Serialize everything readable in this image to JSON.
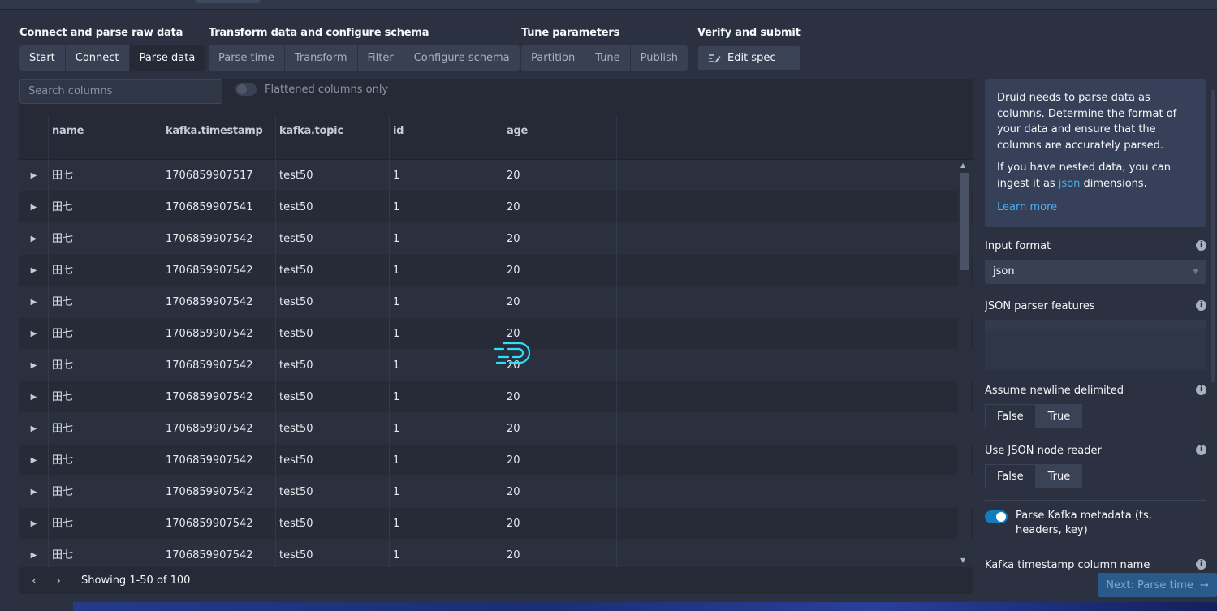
{
  "steps": {
    "group1": {
      "title": "Connect and parse raw data",
      "items": [
        "Start",
        "Connect",
        "Parse data"
      ]
    },
    "group2": {
      "title": "Transform data and configure schema",
      "items": [
        "Parse time",
        "Transform",
        "Filter",
        "Configure schema"
      ]
    },
    "group3": {
      "title": "Tune parameters",
      "items": [
        "Partition",
        "Tune",
        "Publish"
      ]
    },
    "group4": {
      "title": "Verify and submit",
      "edit_spec": "Edit spec"
    }
  },
  "search": {
    "placeholder": "Search columns"
  },
  "flattened_toggle": {
    "label": "Flattened columns only",
    "checked": false
  },
  "table": {
    "columns": [
      "name",
      "kafka.timestamp",
      "kafka.topic",
      "id",
      "age"
    ],
    "rows": [
      [
        "田七",
        "1706859907517",
        "test50",
        "1",
        "20"
      ],
      [
        "田七",
        "1706859907541",
        "test50",
        "1",
        "20"
      ],
      [
        "田七",
        "1706859907542",
        "test50",
        "1",
        "20"
      ],
      [
        "田七",
        "1706859907542",
        "test50",
        "1",
        "20"
      ],
      [
        "田七",
        "1706859907542",
        "test50",
        "1",
        "20"
      ],
      [
        "田七",
        "1706859907542",
        "test50",
        "1",
        "20"
      ],
      [
        "田七",
        "1706859907542",
        "test50",
        "1",
        "20"
      ],
      [
        "田七",
        "1706859907542",
        "test50",
        "1",
        "20"
      ],
      [
        "田七",
        "1706859907542",
        "test50",
        "1",
        "20"
      ],
      [
        "田七",
        "1706859907542",
        "test50",
        "1",
        "20"
      ],
      [
        "田七",
        "1706859907542",
        "test50",
        "1",
        "20"
      ],
      [
        "田七",
        "1706859907542",
        "test50",
        "1",
        "20"
      ],
      [
        "田七",
        "1706859907542",
        "test50",
        "1",
        "20"
      ]
    ]
  },
  "pager": {
    "info": "Showing 1-50 of 100"
  },
  "side": {
    "info_p1": "Druid needs to parse data as columns. Determine the format of your data and ensure that the columns are accurately parsed.",
    "info_p2_before": "If you have nested data, you can ingest it as ",
    "info_p2_link": "json",
    "info_p2_after": " dimensions.",
    "learn_more": "Learn more",
    "input_format_label": "Input format",
    "input_format_value": "json",
    "json_parser_label": "JSON parser features",
    "newline_label": "Assume newline delimited",
    "node_reader_label": "Use JSON node reader",
    "false_label": "False",
    "true_label": "True",
    "kafka_metadata_label": "Parse Kafka metadata (ts, headers, key)",
    "kafka_ts_label": "Kafka timestamp column name"
  },
  "next_button": "Next: Parse time",
  "colors": {
    "accent": "#137cbd",
    "link": "#48aff0",
    "loader": "#2ee0f5"
  }
}
